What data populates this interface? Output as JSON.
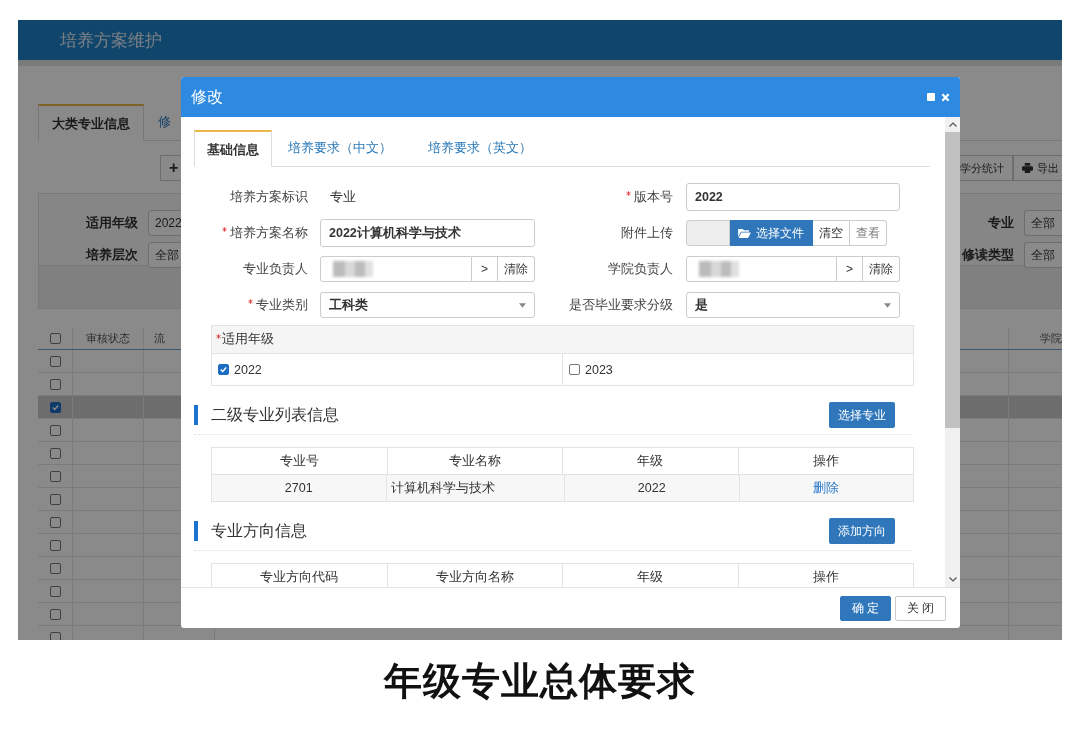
{
  "app": {
    "title": "培养方案维护",
    "tabs": [
      {
        "label": "大类专业信息",
        "selected": true
      },
      {
        "label": "修",
        "selected": false
      }
    ],
    "toolbar": [
      {
        "kind": "add",
        "label": "+"
      },
      {
        "kind": "text",
        "label": "学分统计"
      },
      {
        "kind": "print",
        "label": "导出"
      }
    ],
    "filters_left": [
      {
        "label": "适用年级",
        "value": "2022"
      },
      {
        "label": "培养层次",
        "value": "全部"
      }
    ],
    "filters_right": [
      {
        "label": "专业",
        "value": "全部"
      },
      {
        "label": "修读类型",
        "value": "全部"
      }
    ],
    "table": {
      "all_checked": false,
      "columns": [
        "审核状态",
        "流",
        "学院"
      ],
      "rows": [
        {
          "selected": false
        },
        {
          "selected": false
        },
        {
          "selected": true
        },
        {
          "selected": false
        },
        {
          "selected": false
        },
        {
          "selected": false
        },
        {
          "selected": false
        },
        {
          "selected": false
        },
        {
          "selected": false
        },
        {
          "selected": false
        },
        {
          "selected": false
        },
        {
          "selected": false
        },
        {
          "selected": false
        }
      ]
    }
  },
  "dialog": {
    "title": "修改",
    "tabs": [
      {
        "label": "基础信息",
        "selected": true
      },
      {
        "label": "培养要求（中文）",
        "selected": false
      },
      {
        "label": "培养要求（英文）",
        "selected": false
      }
    ],
    "form_rows": [
      [
        {
          "label": "培养方案标识",
          "required": false,
          "kind": "static",
          "value": "专业"
        },
        {
          "label": "版本号",
          "required": true,
          "kind": "text",
          "value": "2022"
        }
      ],
      [
        {
          "label": "培养方案名称",
          "required": true,
          "kind": "text",
          "value": "2022计算机科学与技术"
        },
        {
          "label": "附件上传",
          "required": false,
          "kind": "file",
          "buttons": [
            "选择文件",
            "清空",
            "查看"
          ]
        }
      ],
      [
        {
          "label": "专业负责人",
          "required": false,
          "kind": "picker",
          "buttons": [
            ">",
            "清除"
          ]
        },
        {
          "label": "学院负责人",
          "required": false,
          "kind": "picker",
          "buttons": [
            ">",
            "清除"
          ]
        }
      ],
      [
        {
          "label": "专业类别",
          "required": true,
          "kind": "select",
          "value": "工科类"
        },
        {
          "label": "是否毕业要求分级",
          "required": false,
          "kind": "select",
          "value": "是"
        }
      ]
    ],
    "grades": {
      "label": "适用年级",
      "required": true,
      "options": [
        {
          "label": "2022",
          "checked": true
        },
        {
          "label": "2023",
          "checked": false
        }
      ]
    },
    "sections": [
      {
        "title": "二级专业列表信息",
        "button": "选择专业",
        "columns": [
          "专业号",
          "专业名称",
          "年级",
          "操作"
        ],
        "rows": [
          {
            "cells": [
              "2701",
              "计算机科学与技术",
              "2022"
            ],
            "action": "删除"
          }
        ]
      },
      {
        "title": "专业方向信息",
        "button": "添加方向",
        "columns": [
          "专业方向代码",
          "专业方向名称",
          "年级",
          "操作"
        ]
      }
    ],
    "buttons": [
      {
        "label": "确 定",
        "kind": "primary"
      },
      {
        "label": "关 闭",
        "kind": "default"
      }
    ]
  },
  "caption": "年级专业总体要求"
}
